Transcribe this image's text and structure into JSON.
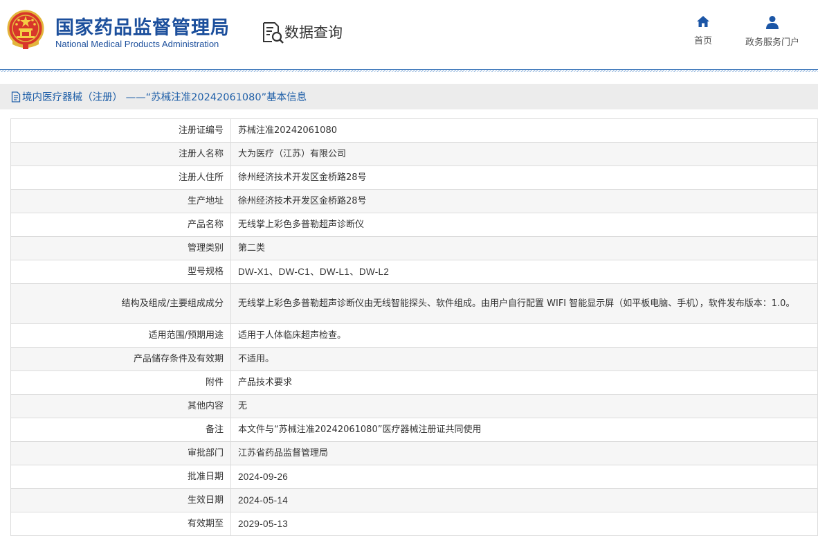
{
  "header": {
    "org_name_cn": "国家药品监督管理局",
    "org_name_en": "National Medical Products Administration",
    "page_title": "数据查询",
    "nav": [
      {
        "label": "首页",
        "icon": "home-icon"
      },
      {
        "label": "政务服务门户",
        "icon": "user-icon"
      }
    ],
    "brand_color": "#1c4f9c"
  },
  "section": {
    "title": "境内医疗器械（注册） ——“苏械注准20242061080”基本信息",
    "icon": "document-icon"
  },
  "fields": [
    {
      "label": "注册证编号",
      "value": "苏械注准20242061080"
    },
    {
      "label": "注册人名称",
      "value": "大为医疗（江苏）有限公司"
    },
    {
      "label": "注册人住所",
      "value": "徐州经济技术开发区金桥路28号"
    },
    {
      "label": "生产地址",
      "value": "徐州经济技术开发区金桥路28号"
    },
    {
      "label": "产品名称",
      "value": "无线掌上彩色多普勒超声诊断仪"
    },
    {
      "label": "管理类别",
      "value": "第二类"
    },
    {
      "label": "型号规格",
      "value": "DW-X1、DW-C1、DW-L1、DW-L2"
    },
    {
      "label": "结构及组成/主要组成成分",
      "value": "无线掌上彩色多普勒超声诊断仪由无线智能探头、软件组成。由用户自行配置 WIFI 智能显示屏（如平板电脑、手机），软件发布版本：1.0。"
    },
    {
      "label": "适用范围/预期用途",
      "value": "适用于人体临床超声检查。"
    },
    {
      "label": "产品储存条件及有效期",
      "value": "不适用。"
    },
    {
      "label": "附件",
      "value": "产品技术要求"
    },
    {
      "label": "其他内容",
      "value": "无"
    },
    {
      "label": "备注",
      "value": "本文件与“苏械注准20242061080”医疗器械注册证共同使用"
    },
    {
      "label": "审批部门",
      "value": "江苏省药品监督管理局"
    },
    {
      "label": "批准日期",
      "value": "2024-09-26"
    },
    {
      "label": "生效日期",
      "value": "2024-05-14"
    },
    {
      "label": "有效期至",
      "value": "2029-05-13"
    }
  ]
}
